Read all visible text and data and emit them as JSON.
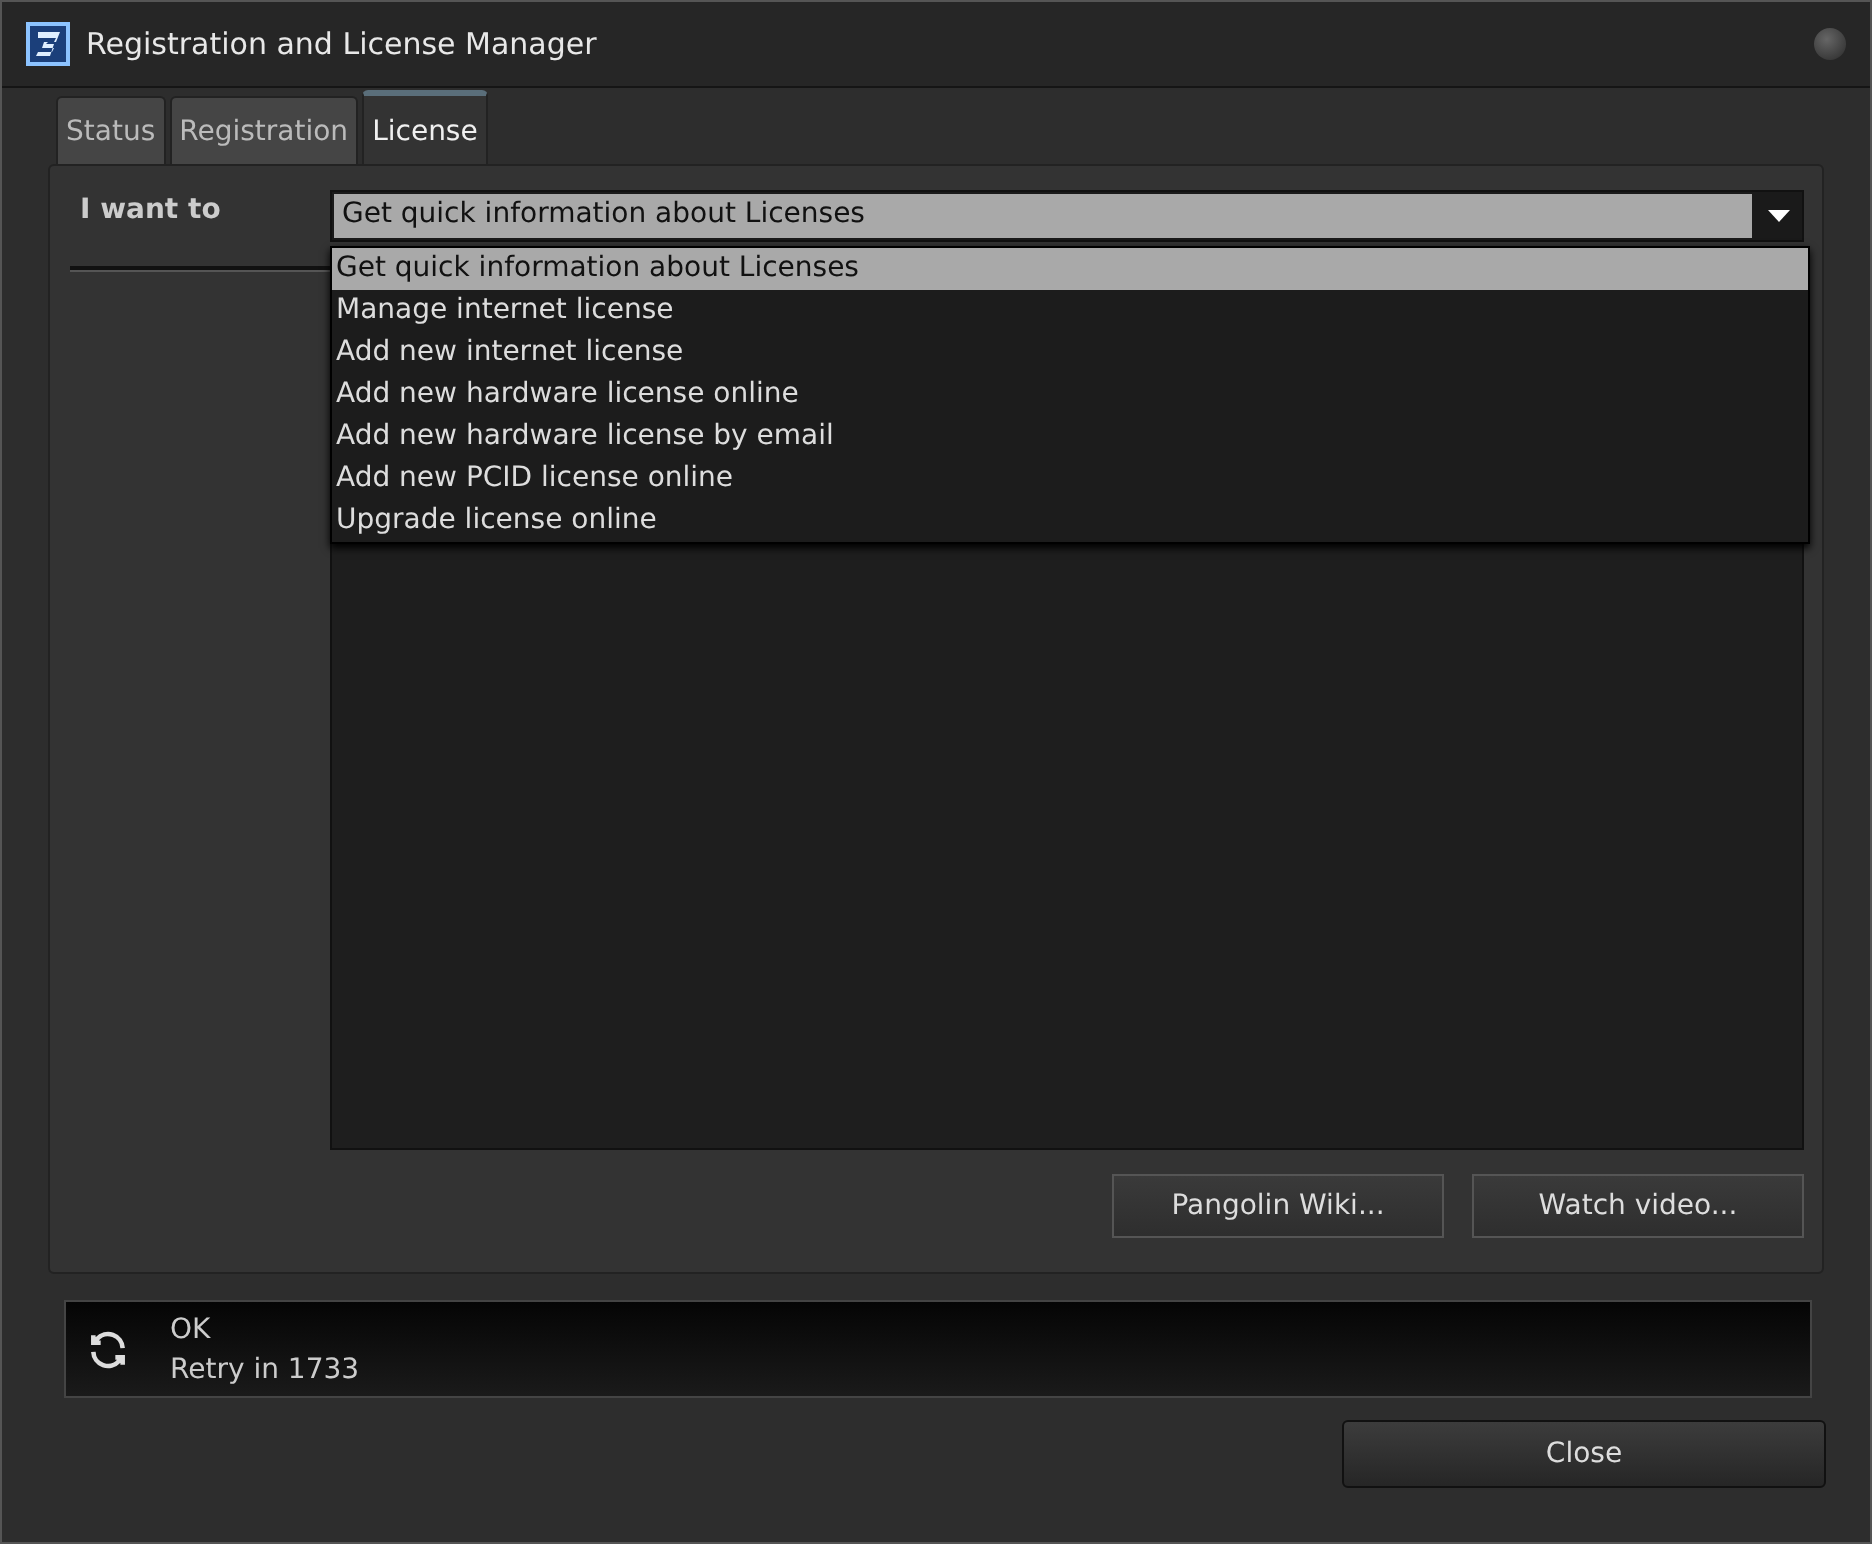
{
  "window": {
    "title": "Registration and License Manager"
  },
  "tabs": [
    {
      "label": "Status",
      "selected": false
    },
    {
      "label": "Registration",
      "selected": false
    },
    {
      "label": "License",
      "selected": true
    }
  ],
  "form": {
    "label": "I want to",
    "value": "Get quick information about Licenses",
    "expanded": true,
    "options": [
      {
        "label": "Get quick information about Licenses",
        "selected": true
      },
      {
        "label": "Manage internet license",
        "selected": false
      },
      {
        "label": "Add new internet license",
        "selected": false
      },
      {
        "label": "Add new hardware license online",
        "selected": false
      },
      {
        "label": "Add new hardware license by email",
        "selected": false
      },
      {
        "label": "Add new PCID license online",
        "selected": false
      },
      {
        "label": "Upgrade license online",
        "selected": false
      }
    ]
  },
  "buttons": [
    "Pangolin Wiki...",
    "Watch video..."
  ],
  "status": {
    "lines": [
      "OK",
      "Retry in 1733"
    ]
  },
  "close_button": "Close"
}
